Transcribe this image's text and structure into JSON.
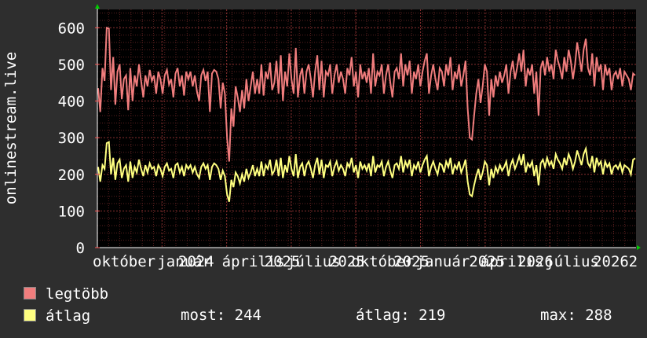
{
  "chart_data": {
    "type": "line",
    "ylabel": "onlinestream.live",
    "ylim": [
      0,
      650
    ],
    "y_ticks": [
      0,
      100,
      200,
      300,
      400,
      500,
      600
    ],
    "x_ticks": [
      {
        "t": 0,
        "label": "október"
      },
      {
        "t": 0.12,
        "label": "január"
      },
      {
        "t": 0.24,
        "label": "április"
      },
      {
        "t": 0.36,
        "label": "július"
      },
      {
        "t": 0.48,
        "label": "október"
      },
      {
        "t": 0.6,
        "label": "január"
      },
      {
        "t": 0.72,
        "label": "április"
      },
      {
        "t": 0.84,
        "label": "július"
      },
      {
        "t": 0.995,
        "label": "2"
      }
    ],
    "year_labels": [
      {
        "t": 0.15,
        "label": "2024"
      },
      {
        "t": 0.31,
        "label": "2025"
      },
      {
        "t": 0.43,
        "label": "2025"
      },
      {
        "t": 0.55,
        "label": "2025"
      },
      {
        "t": 0.69,
        "label": "2025"
      },
      {
        "t": 0.78,
        "label": "2026"
      },
      {
        "t": 0.92,
        "label": "2026"
      }
    ],
    "grid": true,
    "series": [
      {
        "name": "legtöbb",
        "color": "#f07d7d",
        "values": [
          435,
          370,
          490,
          455,
          600,
          598,
          430,
          520,
          390,
          480,
          500,
          405,
          460,
          470,
          375,
          490,
          400,
          470,
          440,
          500,
          455,
          410,
          470,
          440,
          485,
          455,
          470,
          420,
          480,
          460,
          420,
          470,
          485,
          445,
          460,
          410,
          475,
          490,
          440,
          470,
          415,
          480,
          460,
          480,
          440,
          470,
          425,
          400,
          470,
          485,
          455,
          480,
          370,
          475,
          485,
          480,
          460,
          380,
          450,
          420,
          300,
          235,
          380,
          330,
          440,
          410,
          370,
          430,
          380,
          460,
          400,
          440,
          480,
          420,
          460,
          420,
          500,
          415,
          480,
          460,
          505,
          430,
          450,
          510,
          420,
          525,
          400,
          480,
          440,
          530,
          460,
          420,
          545,
          410,
          470,
          490,
          420,
          480,
          500,
          460,
          410,
          480,
          525,
          430,
          510,
          410,
          480,
          470,
          500,
          420,
          470,
          500,
          450,
          480,
          460,
          420,
          490,
          470,
          520,
          440,
          480,
          410,
          500,
          460,
          480,
          450,
          490,
          420,
          530,
          440,
          480,
          470,
          500,
          420,
          470,
          500,
          450,
          410,
          480,
          490,
          460,
          530,
          440,
          500,
          470,
          510,
          420,
          480,
          460,
          500,
          440,
          480,
          510,
          530,
          420,
          470,
          500,
          460,
          430,
          490,
          480,
          440,
          500,
          470,
          520,
          430,
          480,
          460,
          500,
          440,
          470,
          510,
          380,
          300,
          295,
          360,
          420,
          460,
          395,
          440,
          500,
          480,
          360,
          460,
          410,
          470,
          440,
          480,
          450,
          470,
          500,
          420,
          480,
          510,
          460,
          490,
          530,
          480,
          540,
          440,
          490,
          470,
          500,
          420,
          480,
          360,
          490,
          510,
          470,
          520,
          480,
          500,
          460,
          540,
          510,
          490,
          460,
          520,
          480,
          540,
          510,
          460,
          500,
          560,
          520,
          480,
          540,
          570,
          490,
          470,
          530,
          440,
          520,
          480,
          500,
          430,
          500,
          470,
          490,
          430,
          470,
          480,
          460,
          490,
          440,
          480,
          470,
          460,
          430,
          475,
          470
        ]
      },
      {
        "name": "átlag",
        "color": "#ffff80",
        "values": [
          220,
          180,
          225,
          215,
          285,
          288,
          200,
          245,
          185,
          230,
          240,
          190,
          215,
          225,
          180,
          235,
          190,
          220,
          205,
          240,
          215,
          195,
          225,
          205,
          230,
          215,
          220,
          195,
          225,
          215,
          195,
          220,
          230,
          210,
          215,
          190,
          225,
          230,
          205,
          220,
          195,
          225,
          215,
          225,
          205,
          220,
          200,
          190,
          220,
          230,
          215,
          225,
          185,
          220,
          230,
          225,
          215,
          185,
          210,
          195,
          145,
          125,
          185,
          165,
          205,
          195,
          175,
          200,
          180,
          215,
          190,
          205,
          225,
          195,
          215,
          195,
          235,
          195,
          225,
          215,
          240,
          200,
          210,
          240,
          195,
          245,
          190,
          225,
          205,
          250,
          215,
          195,
          255,
          190,
          220,
          230,
          195,
          225,
          235,
          215,
          190,
          225,
          245,
          200,
          240,
          190,
          225,
          220,
          235,
          195,
          220,
          235,
          210,
          225,
          215,
          195,
          230,
          220,
          245,
          205,
          225,
          190,
          235,
          215,
          225,
          210,
          230,
          195,
          250,
          205,
          225,
          220,
          235,
          195,
          220,
          235,
          210,
          190,
          225,
          230,
          215,
          250,
          205,
          235,
          220,
          240,
          195,
          225,
          215,
          235,
          205,
          225,
          240,
          250,
          195,
          220,
          235,
          215,
          200,
          230,
          225,
          205,
          235,
          220,
          245,
          200,
          225,
          215,
          235,
          205,
          220,
          240,
          180,
          145,
          140,
          170,
          195,
          215,
          185,
          205,
          235,
          225,
          170,
          215,
          190,
          220,
          205,
          225,
          210,
          220,
          235,
          195,
          225,
          240,
          215,
          230,
          250,
          225,
          255,
          205,
          230,
          220,
          235,
          195,
          225,
          170,
          230,
          240,
          220,
          245,
          225,
          235,
          215,
          255,
          240,
          230,
          215,
          245,
          225,
          255,
          240,
          215,
          235,
          265,
          245,
          225,
          255,
          270,
          230,
          220,
          250,
          205,
          245,
          225,
          235,
          200,
          235,
          220,
          230,
          200,
          220,
          225,
          215,
          230,
          205,
          225,
          220,
          215,
          200,
          240,
          244
        ]
      }
    ]
  },
  "legend": [
    {
      "label": "legtöbb",
      "color": "#f07d7d"
    },
    {
      "label": "átlag",
      "color": "#ffff80"
    }
  ],
  "stats": {
    "now": "most: 244",
    "avg": "átlag: 219",
    "max": "max: 288"
  }
}
